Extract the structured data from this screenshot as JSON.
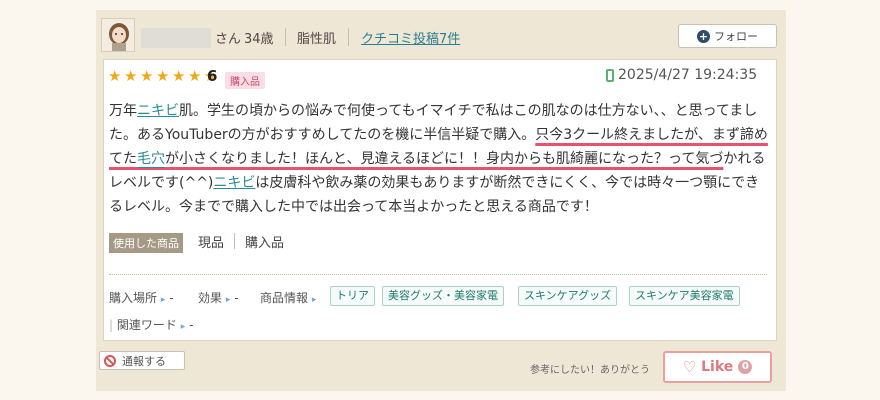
{
  "header": {
    "suffix": "さん",
    "age": "34歳",
    "skin_type": "脂性肌",
    "post_count_link": "クチコミ投稿7件",
    "follow_label": "フォロー"
  },
  "review": {
    "rating": "6",
    "rating_value": 6,
    "rating_max": 7,
    "purchase_badge": "購入品",
    "date": "2025/4/27 19:24:35",
    "body": {
      "p1": "万年",
      "kw1": "ニキビ",
      "p2": "肌。学生の頃からの悩みで何使ってもイマイチで私はこの肌なのは仕方ない、、と思ってました。あるYouTuberの方がおすすめしてたのを機に半信半疑で購入。",
      "hl1": "只今3クール終えましたが、まず諦めてた",
      "kw2": "毛穴",
      "hl2": "が小さくなりました！ほんと、見違えるほどに！！身内からも肌綺麗になった？って気づ",
      "p3": "かれるレベルです(^^)",
      "kw3": "ニキビ",
      "p4": "は皮膚科や飲み薬の効果もありますが断然できにくく、今では時々一つ顎にできるレベル。今までで購入した中では出会って本当よかったと思える商品です！"
    },
    "used_label": "使用した商品",
    "used_items": [
      "現品",
      "購入品"
    ],
    "meta": {
      "place_label": "購入場所",
      "effect_label": "効果",
      "info_label": "商品情報",
      "related_label": "関連ワード",
      "dash": "-",
      "tags": [
        "トリア",
        "美容グッズ・美容家電",
        "スキンケアグッズ",
        "スキンケア美容家電"
      ]
    }
  },
  "footer": {
    "report_label": "通報する",
    "helpful_text": "参考にしたい！ありがとう",
    "like_label": "Like",
    "like_count": "0"
  },
  "colors": {
    "accent": "#2a8c96",
    "highlight": "#e8526e",
    "star": "#f0a81b",
    "like": "#e0797a"
  }
}
